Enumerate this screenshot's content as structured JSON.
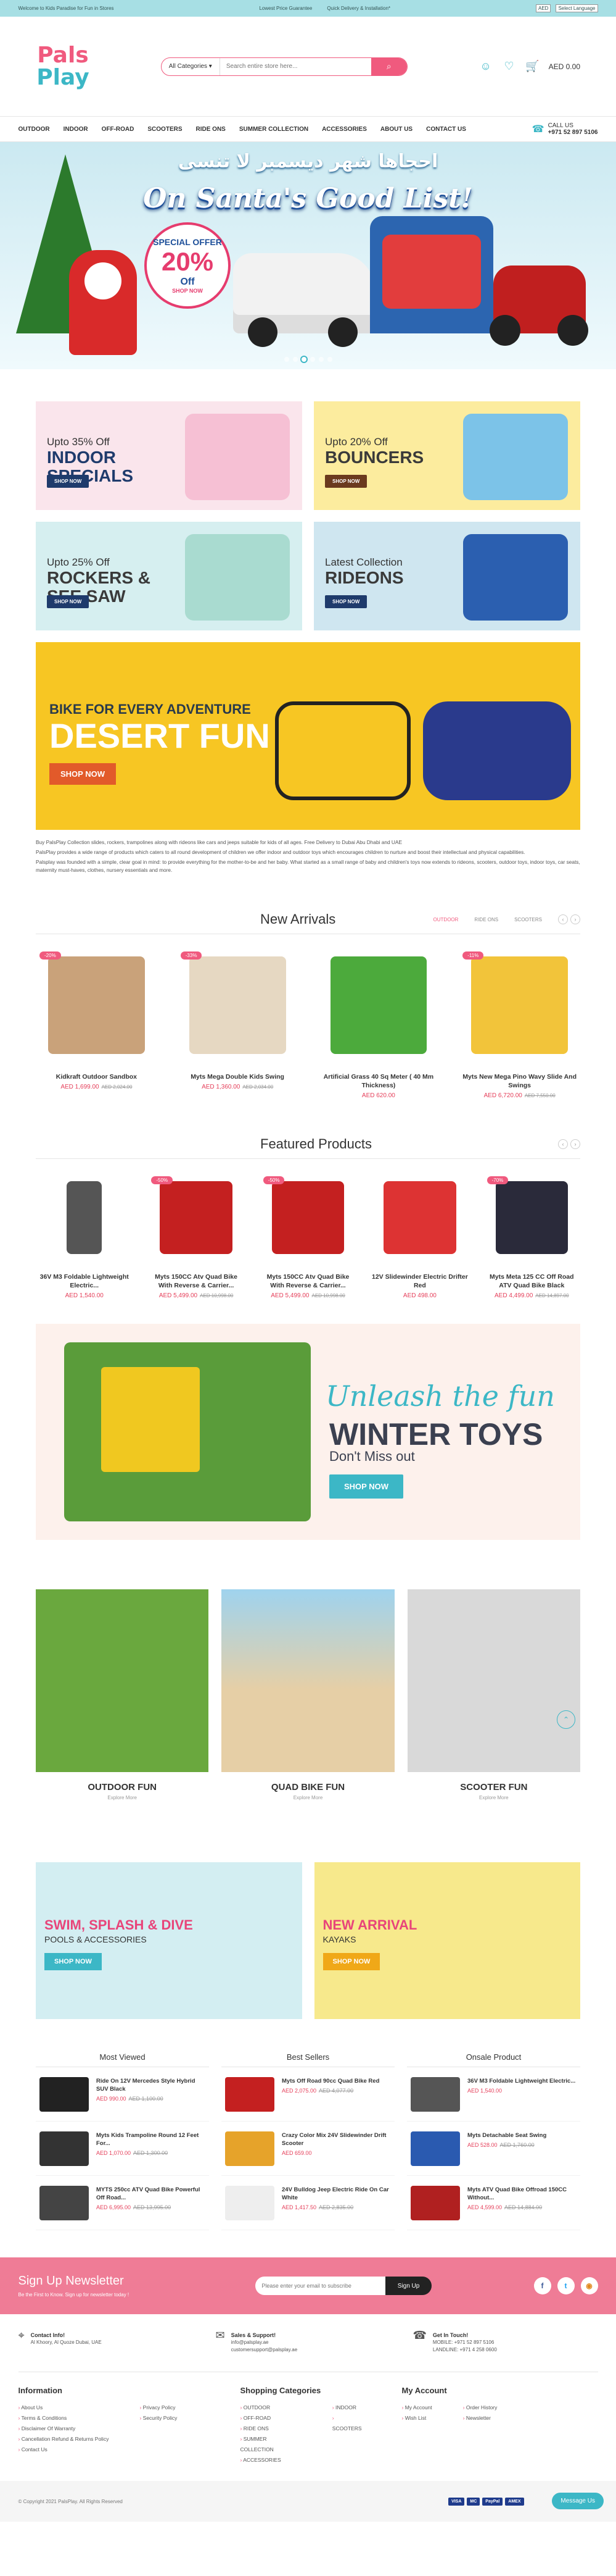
{
  "topbar": {
    "welcome": "Welcome to Kids Paradise for Fun in Stores",
    "usp1": "Lowest Price Guarantee",
    "usp2": "Quick Delivery & Installation*",
    "currency": "AED",
    "language": "Select Language"
  },
  "header": {
    "logo_line1": "Pals",
    "logo_line2": "Play",
    "search_category": "All Categories",
    "search_placeholder": "Search entire store here...",
    "cart_total": "AED 0.00"
  },
  "nav": {
    "items": [
      "OUTDOOR",
      "INDOOR",
      "OFF-ROAD",
      "SCOOTERS",
      "RIDE ONS",
      "SUMMER COLLECTION",
      "ACCESSORIES",
      "ABOUT US",
      "CONTACT US"
    ],
    "phone_label": "CALL US",
    "phone": "+971 52 897 5106"
  },
  "hero": {
    "arabic": "احجاها شهر ديسمبر لا تنسى",
    "headline": "On Santa's Good List!",
    "offer_l1": "SPECIAL OFFER",
    "offer_l2": "20%",
    "offer_l3": "Off",
    "offer_cta": "SHOP NOW"
  },
  "promos": [
    {
      "small": "Upto 35% Off",
      "big": "INDOOR SPECIALS",
      "btn": "SHOP NOW"
    },
    {
      "small": "Upto 20% Off",
      "big": "BOUNCERS",
      "btn": "SHOP NOW"
    },
    {
      "small": "Upto 25% Off",
      "big": "ROCKERS & SEE SAW",
      "btn": "SHOP NOW"
    },
    {
      "small": "Latest Collection",
      "big": "RIDEONS",
      "btn": "SHOP NOW"
    }
  ],
  "desert": {
    "small": "BIKE FOR EVERY ADVENTURE",
    "big": "DESERT FUN",
    "btn": "SHOP NOW"
  },
  "about": {
    "p1": "Buy PalsPlay Collection slides, rockers, trampolines along with rideons like cars and jeeps suitable for kids of all ages. Free Delivery to Dubai Abu Dhabi and UAE",
    "p2": "PalsPlay provides a wide range of products which caters to all round development of children we offer indoor and outdoor toys which encourages children to nurture and boost their intellectual and physical capabilities.",
    "p3": "Palsplay was founded with a simple, clear goal in mind: to provide everything for the mother-to-be and her baby. What started as a small range of baby and children's toys now extends to rideons, scooters, outdoor toys, indoor toys, car seats, maternity must-haves, clothes, nursery essentials and more."
  },
  "new_arrivals": {
    "title": "New Arrivals",
    "tabs": [
      "OUTDOOR",
      "RIDE ONS",
      "SCOOTERS"
    ],
    "products": [
      {
        "badge": "-20%",
        "name": "Kidkraft Outdoor Sandbox",
        "price": "AED 1,699.00",
        "old": "AED 2,024.00"
      },
      {
        "badge": "-33%",
        "name": "Myts Mega Double Kids Swing",
        "price": "AED 1,360.00",
        "old": "AED 2,034.00"
      },
      {
        "badge": "",
        "name": "Artificial Grass 40 Sq Meter ( 40 Mm Thickness)",
        "price": "AED 620.00",
        "old": ""
      },
      {
        "badge": "-11%",
        "name": "Myts New Mega Pino Wavy Slide And Swings",
        "price": "AED 6,720.00",
        "old": "AED 7,550.00"
      }
    ]
  },
  "featured": {
    "title": "Featured Products",
    "products": [
      {
        "badge": "",
        "name": "36V M3 Foldable Lightweight Electric...",
        "price": "AED 1,540.00",
        "old": ""
      },
      {
        "badge": "-50%",
        "name": "Myts 150CC Atv Quad Bike With Reverse & Carrier...",
        "price": "AED 5,499.00",
        "old": "AED 10,998.00"
      },
      {
        "badge": "-50%",
        "name": "Myts 150CC Atv Quad Bike With Reverse & Carrier...",
        "price": "AED 5,499.00",
        "old": "AED 10,998.00"
      },
      {
        "badge": "",
        "name": "12V Slidewinder Electric Drifter Red",
        "price": "AED 498.00",
        "old": ""
      },
      {
        "badge": "-70%",
        "name": "Myts Meta 125 CC Off Road ATV Quad Bike Black",
        "price": "AED 4,499.00",
        "old": "AED 14,897.00"
      }
    ]
  },
  "winter": {
    "t1": "Unleash the fun",
    "t2": "WINTER TOYS",
    "t3": "Don't Miss out",
    "btn": "SHOP NOW"
  },
  "categories": [
    {
      "title": "OUTDOOR FUN",
      "sub": "Explore More"
    },
    {
      "title": "QUAD BIKE FUN",
      "sub": "Explore More"
    },
    {
      "title": "SCOOTER FUN",
      "sub": "Explore More"
    }
  ],
  "banners": [
    {
      "big": "SWIM, SPLASH & DIVE",
      "sm": "POOLS & ACCESSORIES",
      "btn": "SHOP NOW"
    },
    {
      "big": "NEW ARRIVAL",
      "sm": "KAYAKS",
      "btn": "SHOP NOW"
    }
  ],
  "lists": [
    {
      "title": "Most Viewed",
      "items": [
        {
          "name": "Ride On 12V Mercedes Style Hybrid SUV Black",
          "price": "AED 990.00",
          "old": "AED 1,100.00"
        },
        {
          "name": "Myts Kids Trampoline Round 12 Feet For...",
          "price": "AED 1,070.00",
          "old": "AED 1,300.00"
        },
        {
          "name": "MYTS 250cc ATV Quad Bike Powerful Off Road...",
          "price": "AED 6,995.00",
          "old": "AED 13,995.00"
        }
      ]
    },
    {
      "title": "Best Sellers",
      "items": [
        {
          "name": "Myts Off Road 90cc Quad Bike Red",
          "price": "AED 2,075.00",
          "old": "AED 4,077.00"
        },
        {
          "name": "Crazy Color Mix 24V Slidewinder Drift Scooter",
          "price": "AED 659.00",
          "old": ""
        },
        {
          "name": "24V Bulldog Jeep Electric Ride On Car White",
          "price": "AED 1,417.50",
          "old": "AED 2,835.00"
        }
      ]
    },
    {
      "title": "Onsale Product",
      "items": [
        {
          "name": "36V M3 Foldable Lightweight Electric...",
          "price": "AED 1,540.00",
          "old": ""
        },
        {
          "name": "Myts Detachable Seat Swing",
          "price": "AED 528.00",
          "old": "AED 1,760.00"
        },
        {
          "name": "Myts ATV Quad Bike Offroad 150CC Without...",
          "price": "AED 4,599.00",
          "old": "AED 14,884.00"
        }
      ]
    }
  ],
  "newsletter": {
    "title": "Sign Up Newsletter",
    "sub": "Be the First to Know. Sign up for newsletter today !",
    "placeholder": "Please enter your email to subscribe",
    "btn": "Sign Up"
  },
  "contact": [
    {
      "title": "Contact Info!",
      "line1": "Al Khoory, Al Quoze Dubai, UAE",
      "line2": ""
    },
    {
      "title": "Sales & Support!",
      "line1": "info@palsplay.ae",
      "line2": "customersupport@palsplay.ae"
    },
    {
      "title": "Get In Touch!",
      "line1": "MOBILE: +971 52 897 5106",
      "line2": "LANDLINE: +971 4 258 0600"
    }
  ],
  "footer": {
    "info_title": "Information",
    "info_col1": [
      "About Us",
      "Terms & Conditions",
      "Disclaimer Of Warranty",
      "Cancellation Refund & Returns Policy",
      "Contact Us"
    ],
    "info_col2": [
      "Privacy Policy",
      "Security Policy"
    ],
    "shop_title": "Shopping Categories",
    "shop_col1": [
      "OUTDOOR",
      "OFF-ROAD",
      "RIDE ONS",
      "SUMMER COLLECTION",
      "ACCESSORIES"
    ],
    "shop_col2": [
      "INDOOR",
      "SCOOTERS"
    ],
    "acct_title": "My Account",
    "acct_col1": [
      "My Account",
      "Wish List"
    ],
    "acct_col2": [
      "Order History",
      "Newsletter"
    ],
    "copyright": "© Copyright 2021 PalsPlay. All Rights Reserved",
    "payments": [
      "VISA",
      "MC",
      "PayPal",
      "AMEX"
    ],
    "message_us": "Message Us"
  },
  "colors": {
    "accent": "#f05a7e",
    "teal": "#3cb7c6",
    "navy": "#1f3b6c"
  }
}
